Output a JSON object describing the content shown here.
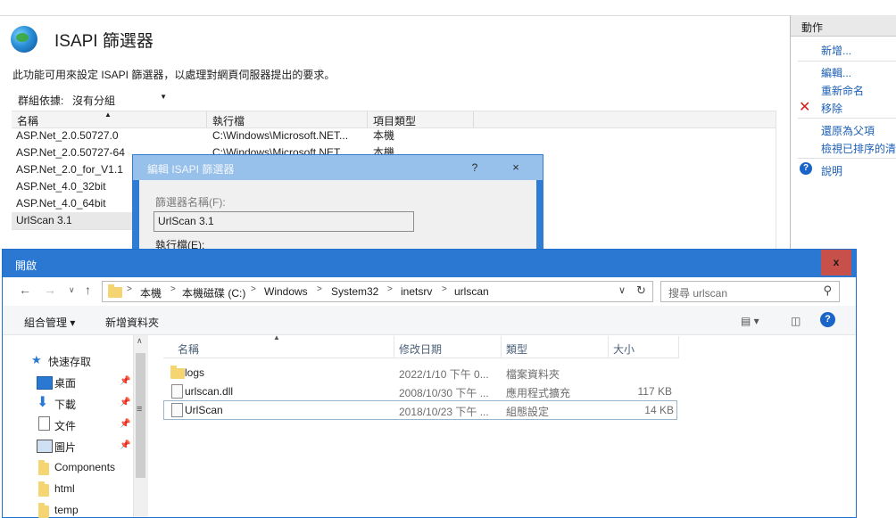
{
  "iis": {
    "title": "ISAPI 篩選器",
    "description": "此功能可用來設定 ISAPI 篩選器，以處理對網頁伺服器提出的要求。",
    "group_label": "群組依據:",
    "group_value": "沒有分組",
    "columns": [
      "名稱",
      "執行檔",
      "項目類型"
    ],
    "rows": [
      {
        "name": "ASP.Net_2.0.50727.0",
        "exe": "C:\\Windows\\Microsoft.NET...",
        "type": "本機"
      },
      {
        "name": "ASP.Net_2.0.50727-64",
        "exe": "C:\\Windows\\Microsoft.NET...",
        "type": "本機"
      },
      {
        "name": "ASP.Net_2.0_for_V1.1",
        "exe": "",
        "type": ""
      },
      {
        "name": "ASP.Net_4.0_32bit",
        "exe": "",
        "type": ""
      },
      {
        "name": "ASP.Net_4.0_64bit",
        "exe": "",
        "type": ""
      },
      {
        "name": "UrlScan 3.1",
        "exe": "",
        "type": ""
      }
    ]
  },
  "actions": {
    "header": "動作",
    "add": "新增...",
    "edit": "編輯...",
    "rename": "重新命名",
    "remove": "移除",
    "revert": "還原為父項",
    "view_ordered": "檢視已排序的清",
    "help": "說明"
  },
  "edit_dialog": {
    "title": "編輯 ISAPI 篩選器",
    "help_btn": "?",
    "close_btn": "×",
    "name_label": "篩選器名稱(F):",
    "name_value": "UrlScan 3.1",
    "exe_label": "執行檔(E):"
  },
  "open_dialog": {
    "title": "開啟",
    "close_btn": "x",
    "breadcrumb": [
      "本機",
      "本機磁碟 (C:)",
      "Windows",
      "System32",
      "inetsrv",
      "urlscan"
    ],
    "search_placeholder": "搜尋 urlscan",
    "organize": "組合管理 ▾",
    "new_folder": "新增資料夾",
    "nav": [
      {
        "label": "快速存取",
        "icon": "star-icon"
      },
      {
        "label": "桌面",
        "icon": "desktop-icon",
        "pinned": true
      },
      {
        "label": "下載",
        "icon": "download-icon",
        "pinned": true
      },
      {
        "label": "文件",
        "icon": "document-icon",
        "pinned": true
      },
      {
        "label": "圖片",
        "icon": "pictures-icon",
        "pinned": true
      },
      {
        "label": "Components",
        "icon": "folder-icon"
      },
      {
        "label": "html",
        "icon": "folder-icon"
      },
      {
        "label": "temp",
        "icon": "folder-icon"
      }
    ],
    "file_columns": [
      "名稱",
      "修改日期",
      "類型",
      "大小"
    ],
    "files": [
      {
        "name": "logs",
        "date": "2022/1/10 下午 0...",
        "type": "檔案資料夾",
        "size": "",
        "icon": "folder-icon"
      },
      {
        "name": "urlscan.dll",
        "date": "2008/10/30 下午 ...",
        "type": "應用程式擴充",
        "size": "117 KB",
        "icon": "dll-file-icon"
      },
      {
        "name": "UrlScan",
        "date": "2018/10/23 下午 ...",
        "type": "組態設定",
        "size": "14 KB",
        "icon": "config-file-icon"
      }
    ]
  },
  "colors": {
    "accent": "#2a78d1",
    "link": "#1b5fb5",
    "close_red": "#c8504a"
  }
}
